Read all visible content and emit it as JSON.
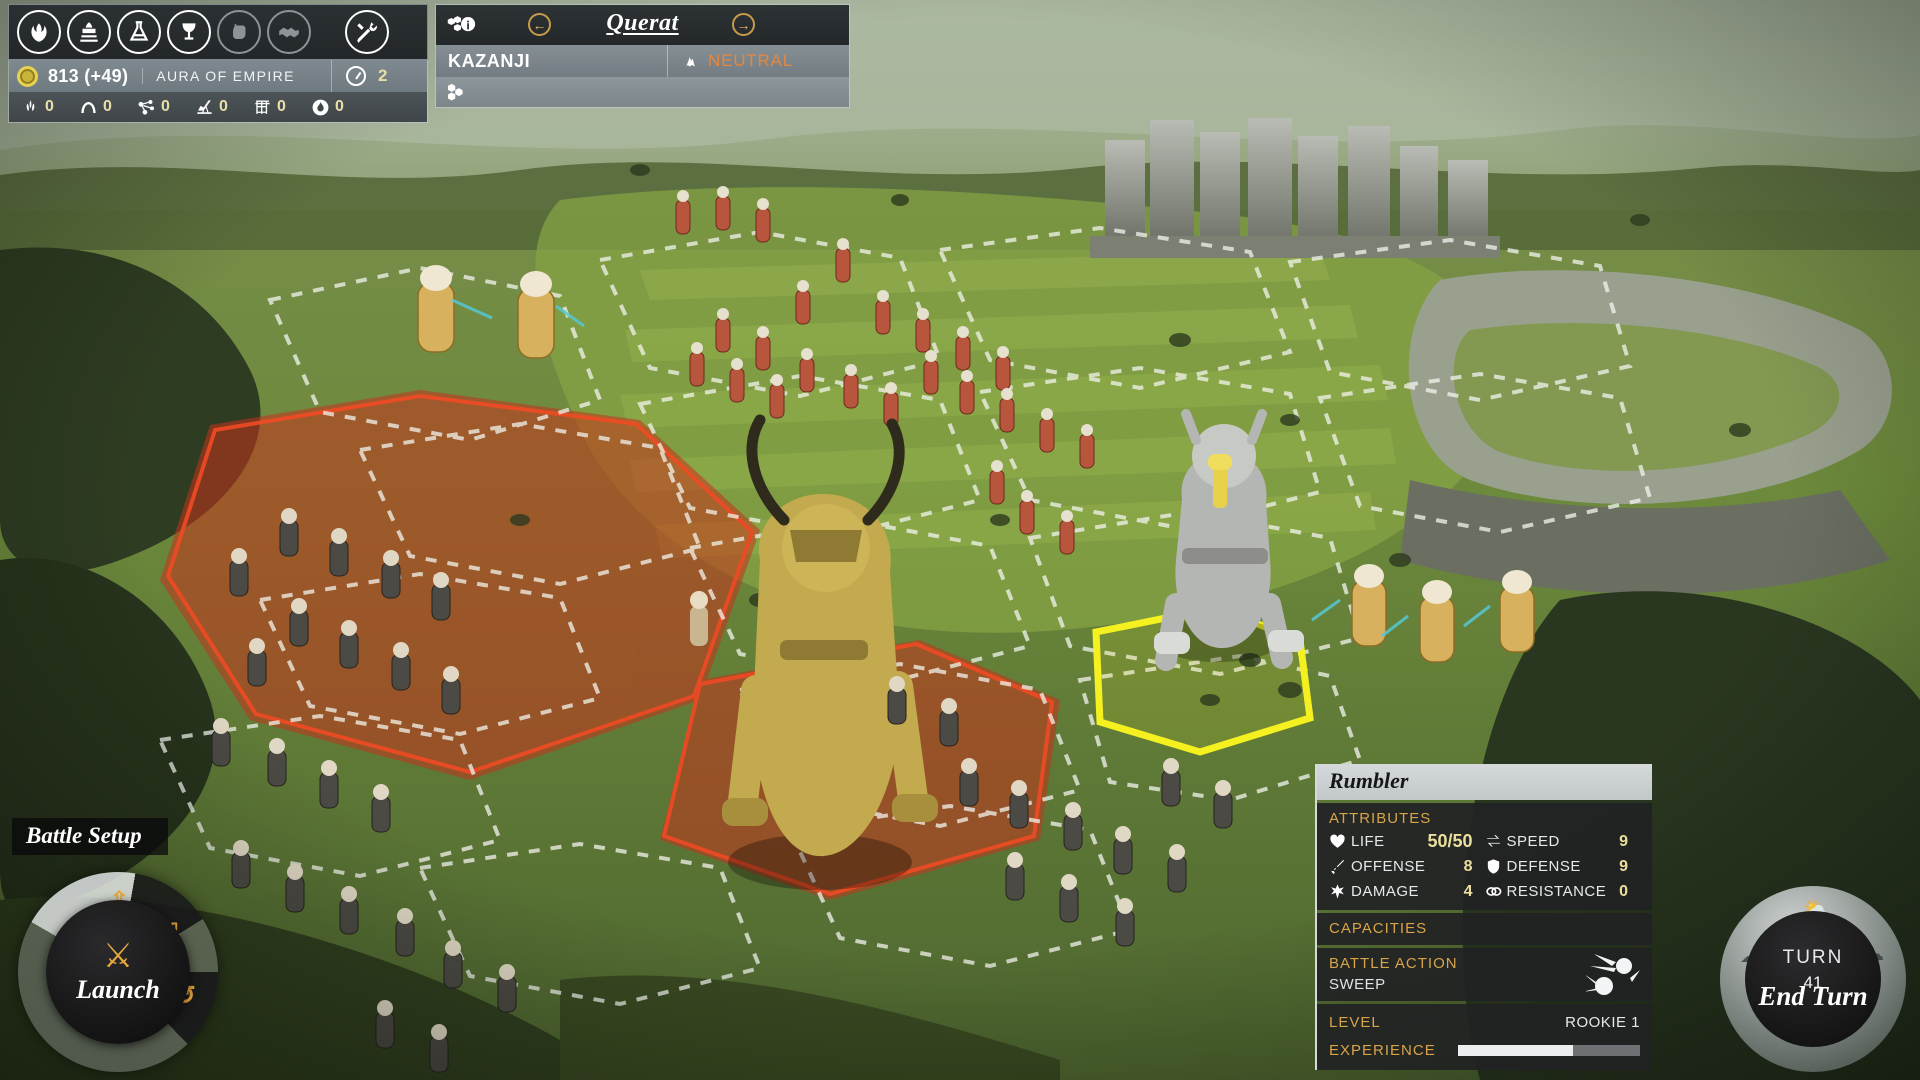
{
  "empire": {
    "icon_bar": [
      {
        "name": "laurel-wreath-icon",
        "label": "Empire",
        "dim": false
      },
      {
        "name": "capitol-building-icon",
        "label": "Cities",
        "dim": false
      },
      {
        "name": "flask-research-icon",
        "label": "Research",
        "dim": false
      },
      {
        "name": "goblet-quest-icon",
        "label": "Quests",
        "dim": false
      },
      {
        "name": "fist-military-icon",
        "label": "Military",
        "dim": true
      },
      {
        "name": "handshake-diplomacy-icon",
        "label": "Diplomacy",
        "dim": true
      },
      {
        "name": "wrench-tools-icon",
        "label": "Options",
        "dim": false
      }
    ],
    "gold": "813 (+49)",
    "aura_label": "AURA OF EMPIRE",
    "turn_marker": "2",
    "resources": [
      {
        "icon": "grain-resource-icon",
        "value": "0"
      },
      {
        "icon": "bow-arc-resource-icon",
        "value": "0"
      },
      {
        "icon": "molecule-resource-icon",
        "value": "0"
      },
      {
        "icon": "oil-derrick-resource-icon",
        "value": "0"
      },
      {
        "icon": "titanium-scaffold-resource-icon",
        "value": "0"
      },
      {
        "icon": "flame-resource-icon",
        "value": "0"
      }
    ]
  },
  "city": {
    "name": "Querat",
    "owner": "KAZANJI",
    "status": "NEUTRAL",
    "status_color": "#e8873c",
    "prev_label": "←",
    "next_label": "→"
  },
  "battle_setup": {
    "title": "Battle Setup",
    "launch_label": "Launch",
    "segments": [
      {
        "name": "promote-up-button",
        "glyph": "⇧"
      },
      {
        "name": "demote-down-button",
        "glyph": "⇩"
      },
      {
        "name": "reset-button",
        "glyph": "↺"
      }
    ]
  },
  "end_turn": {
    "turn_label": "TURN",
    "turn_number": "41",
    "action_label": "End Turn"
  },
  "unit": {
    "name": "Rumbler",
    "sections": {
      "attributes_header": "ATTRIBUTES",
      "capacities_header": "CAPACITIES",
      "battle_action_header": "BATTLE ACTION",
      "level_header": "LEVEL",
      "experience_header": "EXPERIENCE"
    },
    "attributes": [
      {
        "icon": "heart-life-icon",
        "name": "LIFE",
        "value": "50/50"
      },
      {
        "icon": "speed-arrows-icon",
        "name": "SPEED",
        "value": "9"
      },
      {
        "icon": "sword-offense-icon",
        "name": "OFFENSE",
        "value": "8"
      },
      {
        "icon": "shield-defense-icon",
        "name": "DEFENSE",
        "value": "9"
      },
      {
        "icon": "burst-damage-icon",
        "name": "DAMAGE",
        "value": "4"
      },
      {
        "icon": "chain-resistance-icon",
        "name": "RESISTANCE",
        "value": "0"
      }
    ],
    "battle_action": "SWEEP",
    "battle_action_icon": "comet-sweep-icon",
    "level": "ROOKIE 1",
    "experience_percent": 63
  },
  "palette": {
    "gold_text": "#ecdf9e",
    "section_header": "#d8a44a",
    "accent_orange": "#e8873c",
    "wheel_accent": "#e8a93c",
    "selected_hex": "#f5f020",
    "enemy_zone": "#e03a20"
  }
}
